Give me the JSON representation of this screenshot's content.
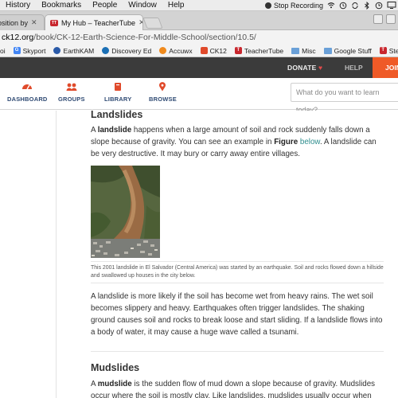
{
  "menubar": {
    "items": [
      "History",
      "Bookmarks",
      "People",
      "Window",
      "Help"
    ],
    "recording_label": "Stop Recording"
  },
  "tabs": [
    {
      "label": "osition by",
      "active": false
    },
    {
      "label": "My Hub – TeacherTube",
      "active": true
    }
  ],
  "address": {
    "host": "ck12.org",
    "path": "/book/CK-12-Earth-Science-For-Middle-School/section/10.5/"
  },
  "bookmarks": [
    {
      "label": "oi",
      "icon": "partial-icon",
      "color": "#888888"
    },
    {
      "label": "Skyport",
      "icon": "google-icon",
      "color": "#4285f4"
    },
    {
      "label": "EarthKAM",
      "icon": "earthkam-icon",
      "color": "#2a5aa8"
    },
    {
      "label": "Discovery Ed",
      "icon": "discovery-icon",
      "color": "#1b6fb5"
    },
    {
      "label": "Accuwx",
      "icon": "accuweather-icon",
      "color": "#f08a1c"
    },
    {
      "label": "CK12",
      "icon": "ck12-icon",
      "color": "#e04a2b"
    },
    {
      "label": "TeacherTube",
      "icon": "teachertube-icon",
      "color": "#c8272e"
    },
    {
      "label": "Misc",
      "icon": "folder-icon",
      "color": "#6aa0d8"
    },
    {
      "label": "Google Stuff",
      "icon": "folder-icon",
      "color": "#6aa0d8"
    },
    {
      "label": "StemCell",
      "icon": "teachertube-icon",
      "color": "#c8272e"
    }
  ],
  "topnav": {
    "donate": "DONATE",
    "help": "HELP",
    "join": "JOIN"
  },
  "subnav": {
    "items": [
      "DASHBOARD",
      "GROUPS",
      "LIBRARY",
      "BROWSE"
    ],
    "search_placeholder": "What do you want to learn today?"
  },
  "content": {
    "landslides_heading": "Landslides",
    "p1_a": "A ",
    "p1_term": "landslide",
    "p1_b": " happens when a large amount of soil and rock suddenly falls down a slope because of gravity. You can see an example in ",
    "p1_fig": "Figure",
    "p1_link": "below",
    "p1_c": ". A landslide can be very destructive. It may bury or carry away entire villages.",
    "caption": "This 2001 landslide in El Salvador (Central America) was started by an earthquake. Soil and rocks flowed down a hillside and swallowed up houses in the city below.",
    "p2": "A landslide is more likely if the soil has become wet from heavy rains. The wet soil becomes slippery and heavy. Earthquakes often trigger landslides. The shaking ground causes soil and rocks to break loose and start sliding. If a landslide flows into a body of water, it may cause a huge wave called a tsunami.",
    "mudslides_heading": "Mudslides",
    "p3_a": "A ",
    "p3_term": "mudslide",
    "p3_b": " is the sudden flow of mud down a slope because of gravity. Mudslides occur where the soil is mostly clay. Like landslides, mudslides usually occur when"
  },
  "colors": {
    "nav_dark": "#3b3b3b",
    "join_orange": "#ef5a27",
    "nav_icon_red": "#e04a2b",
    "nav_text": "#2f4a73",
    "link_teal": "#2d8d8d"
  }
}
